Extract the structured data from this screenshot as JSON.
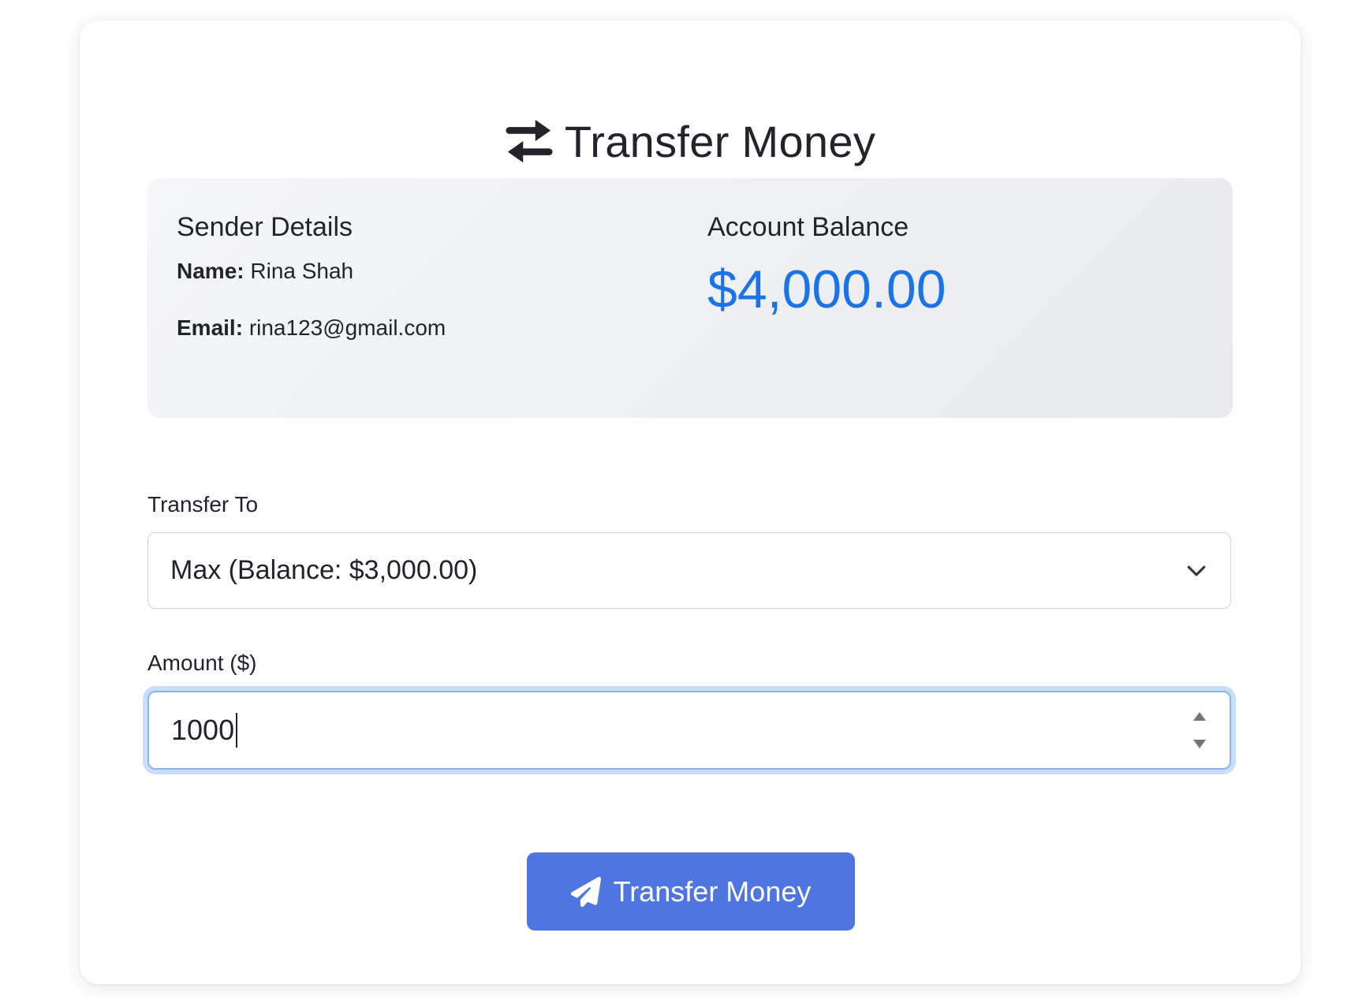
{
  "page": {
    "title": "Transfer Money",
    "title_icon": "exchange-arrows-icon"
  },
  "sender": {
    "heading": "Sender Details",
    "name_label": "Name:",
    "name_value": "Rina Shah",
    "email_label": "Email:",
    "email_value": "rina123@gmail.com"
  },
  "balance": {
    "heading": "Account Balance",
    "amount": "$4,000.00"
  },
  "form": {
    "transfer_to_label": "Transfer To",
    "transfer_to_selected": "Max (Balance: $3,000.00)",
    "amount_label": "Amount ($)",
    "amount_value": "1000",
    "submit_label": "Transfer Money",
    "submit_icon": "paper-plane-icon"
  },
  "colors": {
    "accent_blue": "#1a73e8",
    "button_bg": "#4f76e0",
    "focus_border": "#86b7fe"
  }
}
